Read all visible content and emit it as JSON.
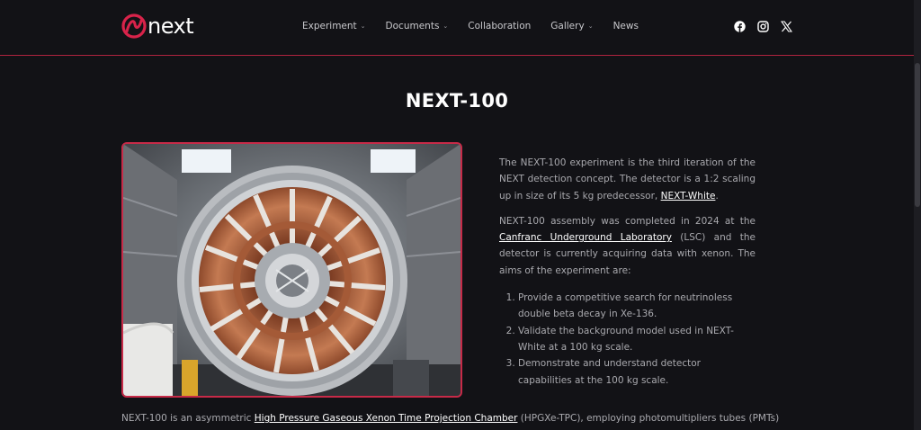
{
  "header": {
    "logo_text": "next",
    "nav": [
      {
        "label": "Experiment",
        "dropdown": true
      },
      {
        "label": "Documents",
        "dropdown": true
      },
      {
        "label": "Collaboration",
        "dropdown": false
      },
      {
        "label": "Gallery",
        "dropdown": true
      },
      {
        "label": "News",
        "dropdown": false
      }
    ],
    "social": [
      "facebook-icon",
      "instagram-icon",
      "x-icon"
    ]
  },
  "colors": {
    "accent": "#c72a48",
    "background": "#121216",
    "title": "#ffffff",
    "body_text": "#a9a9ae"
  },
  "main": {
    "title": "NEXT-100",
    "photo_alt": "NEXT-100 detector",
    "p1_a": "The NEXT-100 experiment is the third iteration of the NEXT detection concept. The detector is a 1:2 scaling up in size of its 5 kg predecessor, ",
    "p1_link": "NEXT-White",
    "p1_b": ".",
    "p2_a": "NEXT-100 assembly was completed in 2024 at the ",
    "p2_link": "Canfranc Underground Laboratory",
    "p2_b": " (LSC) and the detector is currently acquiring data with xenon. The aims of the experiment are:",
    "aims": [
      "Provide a competitive search for neutrinoless double beta decay in Xe-136.",
      "Validate the background model used in NEXT-White at a 100 kg scale.",
      "Demonstrate and understand detector capabilities at the 100 kg scale."
    ],
    "bottom_a": "NEXT-100 is an asymmetric ",
    "bottom_link": "High Pressure Gaseous Xenon Time Projection Chamber",
    "bottom_b": " (HPGXe-TPC), employing photomultipliers tubes (PMTs)"
  }
}
